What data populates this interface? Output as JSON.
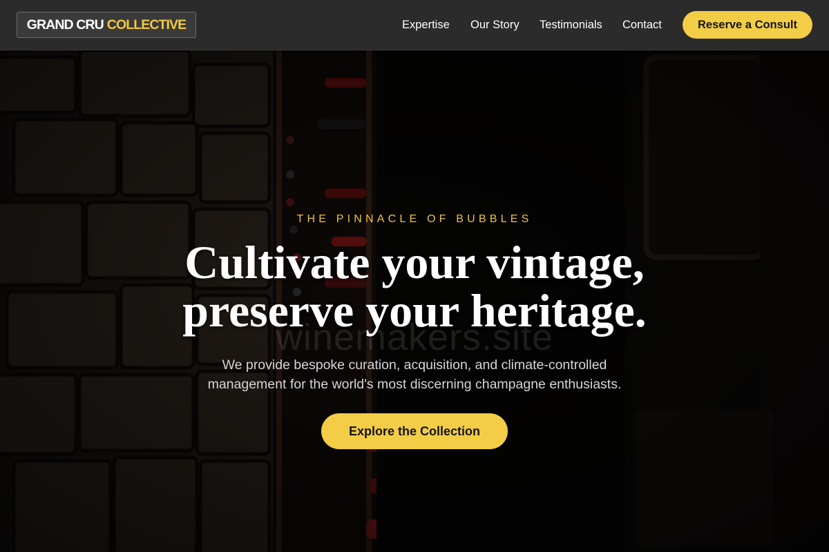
{
  "header": {
    "logo_part1": "GRAND CRU",
    "logo_part2": "COLLECTIVE",
    "nav": [
      {
        "label": "Expertise"
      },
      {
        "label": "Our Story"
      },
      {
        "label": "Testimonials"
      },
      {
        "label": "Contact"
      }
    ],
    "cta_label": "Reserve a Consult"
  },
  "hero": {
    "eyebrow": "THE PINNACLE OF BUBBLES",
    "headline_line1": "Cultivate your vintage,",
    "headline_line2": "preserve your heritage.",
    "watermark": "winemakers.site",
    "subtext_line1": "We provide bespoke curation, acquisition, and climate-controlled",
    "subtext_line2": "management for the world's most discerning champagne enthusiasts.",
    "cta_label": "Explore the Collection",
    "background_image": "wine-cellar-bottles-photo"
  },
  "colors": {
    "accent": "#f3cd45",
    "header_bg": "#2b2b2b",
    "logo_accent": "#f3c93f",
    "eyebrow": "#f0c33c"
  }
}
